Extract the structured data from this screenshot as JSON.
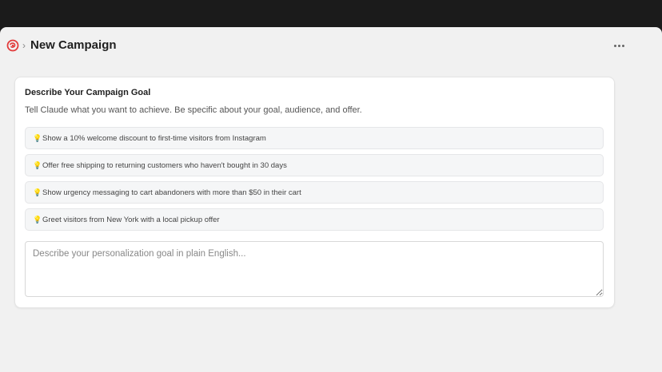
{
  "header": {
    "title": "New Campaign",
    "breadcrumb_separator": "›",
    "logo_icon": "brand-logo-icon",
    "more_icon": "more-horizontal-icon"
  },
  "card": {
    "title": "Describe Your Campaign Goal",
    "subtitle": "Tell Claude what you want to achieve. Be specific about your goal, audience, and offer.",
    "suggestion_icon": "lightbulb-icon",
    "suggestions": [
      "Show a 10% welcome discount to first-time visitors from Instagram",
      "Offer free shipping to returning customers who haven't bought in 30 days",
      "Show urgency messaging to cart abandoners with more than $50 in their cart",
      "Greet visitors from New York with a local pickup offer"
    ],
    "input": {
      "placeholder": "Describe your personalization goal in plain English...",
      "value": ""
    }
  },
  "colors": {
    "brand": "#e23b3b",
    "background": "#f1f1f1",
    "titlebar": "#1b1b1b"
  }
}
